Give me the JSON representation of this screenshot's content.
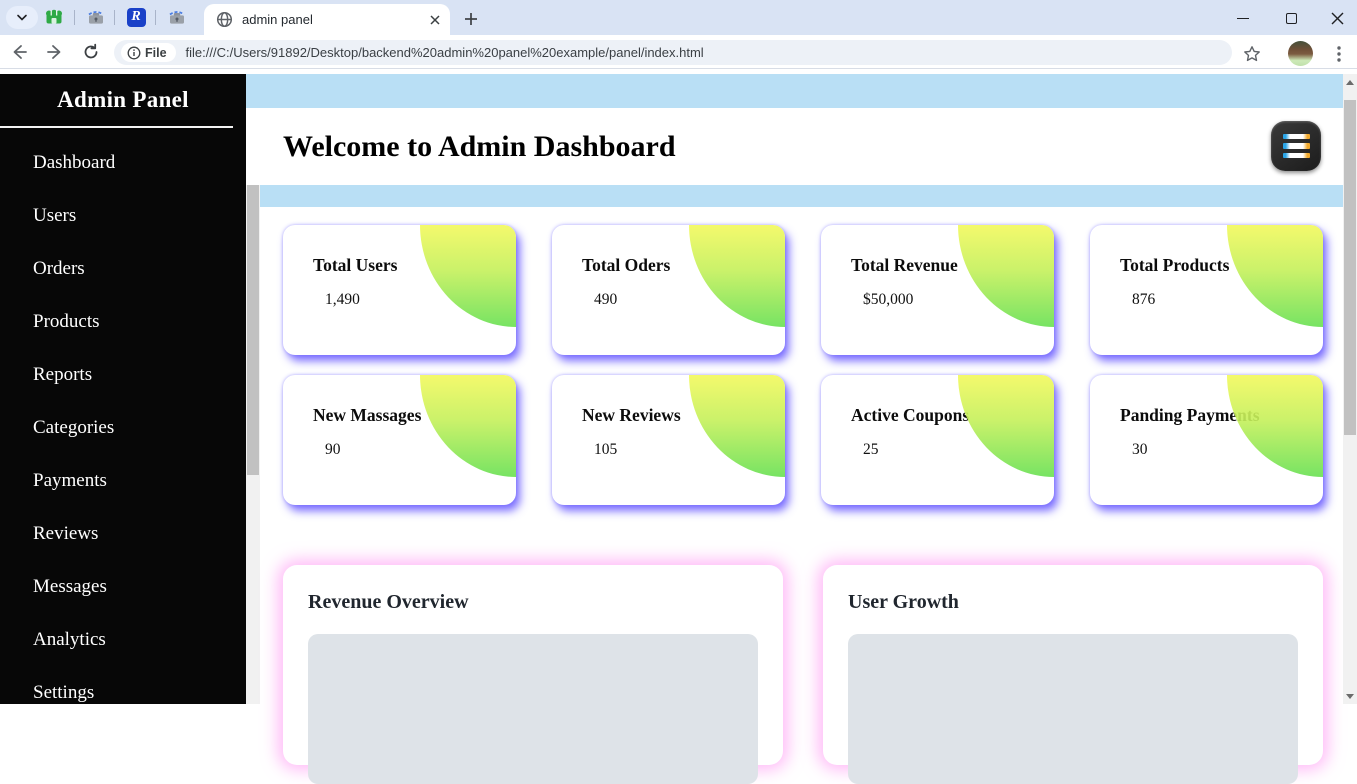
{
  "browser": {
    "tab_title": "admin panel",
    "chip_label": "File",
    "url": "file:///C:/Users/91892/Desktop/backend%20admin%20panel%20example/panel/index.html",
    "pinned_r_letter": "R"
  },
  "sidebar": {
    "title": "Admin Panel",
    "items": [
      "Dashboard",
      "Users",
      "Orders",
      "Products",
      "Reports",
      "Categories",
      "Payments",
      "Reviews",
      "Messages",
      "Analytics",
      "Settings"
    ]
  },
  "header": {
    "title": "Welcome to Admin Dashboard"
  },
  "stats": {
    "items": [
      {
        "label": "Total Users",
        "value": "1,490"
      },
      {
        "label": "Total Oders",
        "value": "490"
      },
      {
        "label": "Total Revenue",
        "value": "$50,000"
      },
      {
        "label": "Total Products",
        "value": "876"
      },
      {
        "label": "New Massages",
        "value": "90"
      },
      {
        "label": "New Reviews",
        "value": "105"
      },
      {
        "label": "Active Coupons",
        "value": "25"
      },
      {
        "label": "Panding Payments",
        "value": "30"
      }
    ]
  },
  "panels": {
    "items": [
      {
        "title": "Revenue Overview"
      },
      {
        "title": "User Growth"
      }
    ]
  },
  "colors": {
    "top_band_blue": "#b9dff5",
    "card_shadow_blue": "#6455ff",
    "decoration_yellow": "#f3f960",
    "decoration_green": "#68e052",
    "panel_glow_pink": "#ff82f0",
    "chart_placeholder_gray": "#dee3e8",
    "sidebar_black": "#070707"
  }
}
